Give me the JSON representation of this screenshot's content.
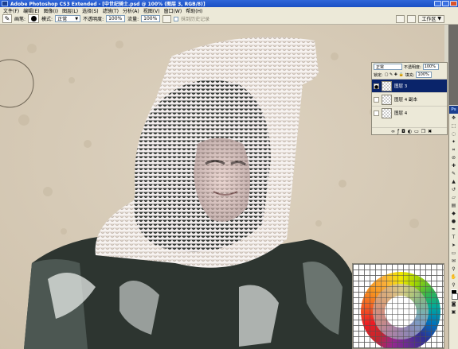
{
  "titlebar": {
    "title": "Adobe Photoshop CS3 Extended - [中世纪骑士.psd @ 100% (图层 3, RGB/8)]"
  },
  "menu": {
    "items": [
      "文件(F)",
      "编辑(E)",
      "图像(I)",
      "图层(L)",
      "选择(S)",
      "滤镜(T)",
      "分析(A)",
      "视图(V)",
      "窗口(W)",
      "帮助(H)"
    ]
  },
  "options": {
    "brush_label": "画笔:",
    "mode_label": "模式:",
    "mode_value": "正常",
    "opacity_label": "不透明度:",
    "opacity_value": "100%",
    "flow_label": "流量:",
    "flow_value": "100%",
    "erase_history_label": "抹到历史记录",
    "workspace_label": "工作区"
  },
  "layers": {
    "blend_mode": "正常",
    "opacity_label": "不透明度:",
    "opacity_value": "100%",
    "lock_label": "锁定:",
    "fill_label": "填充:",
    "fill_value": "100%",
    "items": [
      {
        "name": "图层 3",
        "active": true
      },
      {
        "name": "图层 4 副本",
        "active": false
      },
      {
        "name": "图层 4",
        "active": false
      }
    ]
  },
  "toolbox": {
    "ps_badge": "Ps"
  },
  "colors": {
    "titlebar": "#1a4fc4",
    "chrome": "#ece9d8",
    "canvas_bg": "#d9cdb9",
    "active_layer": "#0a246a"
  }
}
